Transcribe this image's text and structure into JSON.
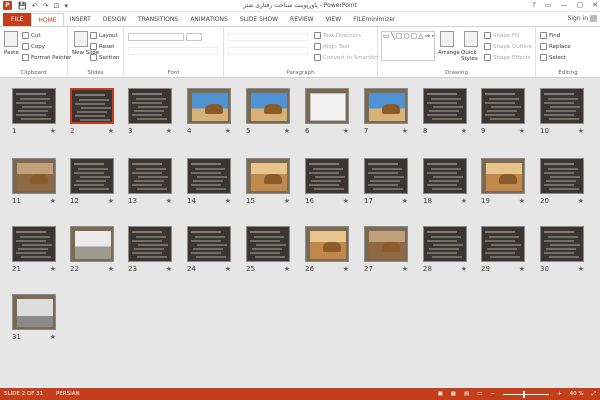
{
  "app": {
    "title": "پاورپوینت شناخت رفتاری شتر - PowerPoint",
    "icon": "P"
  },
  "quick_access": [
    "💾",
    "↶",
    "↷",
    "⊡",
    "▾"
  ],
  "window_controls": [
    "?",
    "▭",
    "—",
    "▢",
    "✕"
  ],
  "tabs": [
    "FILE",
    "HOME",
    "INSERT",
    "DESIGN",
    "TRANSITIONS",
    "ANIMATIONS",
    "SLIDE SHOW",
    "REVIEW",
    "VIEW",
    "FILEminimizer"
  ],
  "active_tab": "HOME",
  "sign_in": "Sign in",
  "ribbon": {
    "clipboard": {
      "label": "Clipboard",
      "paste": "Paste",
      "cut": "Cut",
      "copy": "Copy",
      "format_painter": "Format Painter"
    },
    "slides": {
      "label": "Slides",
      "new_slide": "New Slide",
      "layout": "Layout",
      "reset": "Reset",
      "section": "Section"
    },
    "font": {
      "label": "Font"
    },
    "paragraph": {
      "label": "Paragraph",
      "text_direction": "Text Direction",
      "align_text": "Align Text",
      "convert_smartart": "Convert to SmartArt"
    },
    "drawing": {
      "label": "Drawing",
      "arrange": "Arrange",
      "quick_styles": "Quick Styles",
      "shape_fill": "Shape Fill",
      "shape_outline": "Shape Outline",
      "shape_effects": "Shape Effects"
    },
    "editing": {
      "label": "Editing",
      "find": "Find",
      "replace": "Replace",
      "select": "Select"
    }
  },
  "slides": [
    {
      "n": "1",
      "kind": "text"
    },
    {
      "n": "2",
      "kind": "text",
      "selected": true
    },
    {
      "n": "3",
      "kind": "text"
    },
    {
      "n": "4",
      "kind": "sky"
    },
    {
      "n": "5",
      "kind": "sky"
    },
    {
      "n": "6",
      "kind": "paper"
    },
    {
      "n": "7",
      "kind": "sky"
    },
    {
      "n": "8",
      "kind": "text"
    },
    {
      "n": "9",
      "kind": "text"
    },
    {
      "n": "10",
      "kind": "text"
    },
    {
      "n": "11",
      "kind": "brown"
    },
    {
      "n": "12",
      "kind": "text"
    },
    {
      "n": "13",
      "kind": "text"
    },
    {
      "n": "14",
      "kind": "text"
    },
    {
      "n": "15",
      "kind": "desert"
    },
    {
      "n": "16",
      "kind": "text"
    },
    {
      "n": "17",
      "kind": "text"
    },
    {
      "n": "18",
      "kind": "text"
    },
    {
      "n": "19",
      "kind": "desert"
    },
    {
      "n": "20",
      "kind": "text"
    },
    {
      "n": "21",
      "kind": "text"
    },
    {
      "n": "22",
      "kind": "car"
    },
    {
      "n": "23",
      "kind": "text"
    },
    {
      "n": "24",
      "kind": "text"
    },
    {
      "n": "25",
      "kind": "text"
    },
    {
      "n": "26",
      "kind": "desert"
    },
    {
      "n": "27",
      "kind": "brown"
    },
    {
      "n": "28",
      "kind": "text"
    },
    {
      "n": "29",
      "kind": "text"
    },
    {
      "n": "30",
      "kind": "text"
    },
    {
      "n": "31",
      "kind": "laptop"
    }
  ],
  "star": "★",
  "status": {
    "slide": "SLIDE 2 OF 31",
    "language": "PERSIAN",
    "zoom": "40 %"
  }
}
